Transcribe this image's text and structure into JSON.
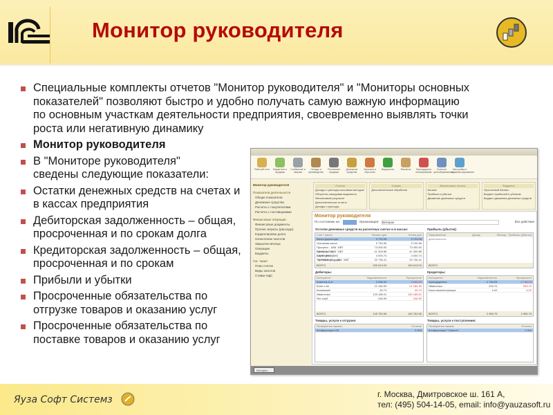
{
  "header": {
    "title": "Монитор руководителя",
    "logo_text": "1С"
  },
  "bullets": [
    "Специальные комплекты отчетов \"Монитор руководителя\" и \"Мониторы основных показателей\" позволяют быстро и удобно получать самую важную информацию по основным участкам деятельности предприятия, своевременно выявлять точки роста или негативную динамику",
    "Монитор руководителя",
    "В \"Мониторе руководителя\" сведены следующие показатели:",
    "Остатки денежных средств на счетах и в кассах предприятия",
    "Дебиторская задолженность – общая, просроченная и по срокам долга",
    "Кредиторская задолженность – общая,  просроченная и по срокам",
    "Прибыли и убытки",
    "Просроченные обязательства по отгрузке товаров и оказанию услуг",
    "Просроченные обязательства по поставке товаров и оказанию услуг"
  ],
  "screenshot": {
    "tools": [
      "Рабочий стол",
      "Маркетинг и продажи",
      "Снабжение и закупки",
      "Склады и производство",
      "Розничные продажи",
      "Денежные средства",
      "Зарплата и персонал",
      "Имущество",
      "Финансы",
      "Календарное планирование",
      "Сметное ценообразование",
      "Настройка и администрирование"
    ],
    "left_title": "Монитор руководителя",
    "left_items": [
      "Показатели деятельности",
      "Общие показатели",
      "Денежные средства",
      "Расчеты с покупателями",
      "Расчеты с поставщиками",
      "Финансовые операции",
      "Финансовые документы",
      "Прочие затраты (расходы)",
      "Корректировка долга",
      "Начисление налогов",
      "Закрытие месяца",
      "Операции",
      "Бюджеты",
      "См. также",
      "План счетов",
      "Виды налогов",
      "Ставки НДС"
    ],
    "menu_groups": [
      {
        "title": "Отчеты",
        "items": [
          "Доходы и расходы кассовым методом",
          "Оборотно-сальдовая ведомость",
          "Финансовый результат",
          "Дополнительные отчеты",
          "Доходы и расходы"
        ]
      },
      {
        "title": "Сервис",
        "items": [
          "Дополнительные обработки"
        ]
      },
      {
        "title": "Финансовые отчеты",
        "items": [
          "Баланс",
          "Прибыли и убытки",
          "Движение денежных средств"
        ]
      },
      {
        "title": "Бюджеты",
        "items": [
          "Прогнозный баланс",
          "Бюджет прибылей и убытков",
          "Бюджет движения денежных средств"
        ]
      }
    ],
    "form_title": "Монитор руководителя",
    "as_of_label": "По состоянию на:",
    "org_label": "Организация:",
    "org_value": "Ветерок",
    "all_actions": "Все действия",
    "cash": {
      "caption": "Остатки денежных средств на расчетных счетах и в кассах:",
      "headers": [
        "Счет / касса",
        "Начало дня",
        "Конец дня"
      ],
      "rows": [
        [
          "Касса директора",
          "9 729.06",
          "9 729.06"
        ],
        [
          "Основная касса",
          "9 740.96",
          "9 740.96"
        ],
        [
          "Прогресс - АКБ \"АВТ БАНК\" (USD)",
          "73 400.00",
          "73 400.00"
        ],
        [
          "Прогресс - АКБ \"АВТ БАНК\" (RUB)",
          "41 309.86",
          "41 309.86"
        ],
        [
          "Сервисник - АКБ \"ТОРГБАНК\" (руб)",
          "4 000.74",
          "4 000.74"
        ],
        [
          "Торговый дом - АКБ \"АВТ БАНК\" (руб)",
          "20 736.41",
          "20 736.41"
        ]
      ],
      "total": [
        "ВСЕГО",
        "159 613.03",
        "159 613.03"
      ]
    },
    "profit": {
      "caption": "Прибыль (убыток):",
      "headers": [
        "Направление деятельности",
        "Доход",
        "Расход",
        "Прибыль (убыток)"
      ],
      "total": "ВСЕГО"
    },
    "debtors": {
      "caption": "Дебиторы:",
      "headers": [
        "Контрагент",
        "Задолженность",
        "Просрочено"
      ],
      "rows": [
        [
          "Ахметов А.А.",
          "3 096.92",
          "3 096.92"
        ],
        [
          "Бонн и Ко",
          "21 184.99",
          "21 184.99"
        ],
        [
          "Белевский",
          "40.73",
          "40.73"
        ],
        [
          "Иванченко",
          "120 185.01",
          "120 185.01"
        ],
        [
          "Яхт-клуб",
          "246.90",
          "246.90"
        ]
      ],
      "total": [
        "ВСЕГО",
        "145 752.65",
        "145 752.65"
      ]
    },
    "creditors": {
      "caption": "Кредиторы:",
      "headers": [
        "Контрагент",
        "Задолженность",
        "Просрочено"
      ],
      "rows": [
        [
          "Арендодатель",
          "2 748.03",
          "2 748.03"
        ],
        [
          "Иванченко",
          "203.70",
          "203.70"
        ],
        [
          "База комплектующих",
          "4.02",
          "4.02"
        ]
      ],
      "total": [
        "ВСЕГО",
        "2 955.75",
        "2 955.75"
      ]
    },
    "ship": {
      "caption": "Товары, услуги к отгрузке:",
      "headers": [
        "Незакрытые заказы",
        "Остаток"
      ],
      "row": [
        "Конференция ОК",
        "2.000"
      ]
    },
    "receive": {
      "caption": "Товары, услуги к поступлению:",
      "headers": [
        "Незакрытые заказы",
        "Остаток"
      ],
      "row": [
        "Конференция \"Самсон\"",
        "1.000"
      ]
    },
    "history_button": "История..."
  },
  "footer": {
    "company": "Яуза Софт Системз",
    "address": "г. Москва, Дмитровское ш. 161 А,",
    "contacts": "тел: (495) 504-14-05, email: info@yauzasoft.ru"
  },
  "colors": {
    "title": "#b50a0a",
    "bullet": "#c0504d",
    "header_bg": "#fbe9a0"
  }
}
